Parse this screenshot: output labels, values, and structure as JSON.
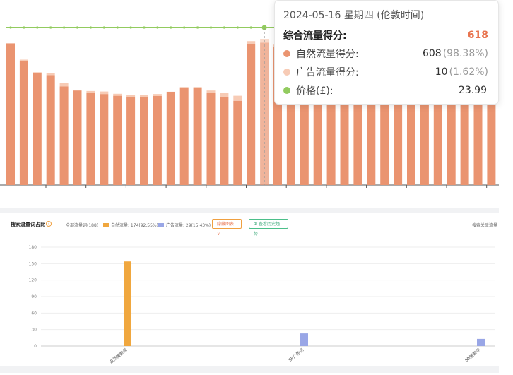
{
  "chart_data": [
    {
      "type": "bar",
      "stacked": true,
      "series": [
        {
          "name": "自然流量得分",
          "color": "#ea9470",
          "values": [
            565,
            495,
            447,
            438,
            393,
            377,
            367,
            363,
            356,
            352,
            352,
            355,
            372,
            386,
            386,
            367,
            352,
            336,
            562,
            568,
            550,
            550,
            550,
            550,
            550,
            550,
            550,
            550,
            550,
            550,
            550,
            550,
            550,
            550,
            550,
            550,
            550
          ]
        },
        {
          "name": "广告流量得分",
          "color": "#f7cbb5",
          "values": [
            0,
            5,
            3,
            8,
            15,
            0,
            8,
            10,
            8,
            8,
            8,
            8,
            0,
            5,
            5,
            10,
            15,
            20,
            12,
            15,
            10,
            10,
            10,
            10,
            10,
            10,
            10,
            10,
            10,
            10,
            10,
            10,
            10,
            10,
            10,
            10,
            10
          ]
        },
        {
          "name": "价格(£)",
          "color": "#92cb5f",
          "type": "line",
          "values": [
            23.99,
            23.99,
            23.99,
            23.99,
            23.99,
            23.99,
            23.99,
            23.99,
            23.99,
            23.99,
            23.99,
            23.99,
            23.99,
            23.99,
            23.99,
            23.99,
            23.99,
            23.99,
            23.99,
            23.99,
            23.99,
            23.99,
            23.99,
            23.99,
            23.99,
            23.99,
            23.99,
            23.99,
            23.99,
            23.99,
            23.99,
            23.99,
            23.99,
            23.99,
            23.99,
            23.99,
            23.99
          ]
        }
      ],
      "highlight_index": 19
    },
    {
      "type": "bar",
      "categories": [
        "自然搜索词",
        "SP广告词",
        "SB搜索词"
      ],
      "series": [
        {
          "name": "自然流量",
          "color": "#f0a73e",
          "values": [
            154,
            0,
            0
          ]
        },
        {
          "name": "广告流量",
          "color": "#99a6e6",
          "values": [
            0,
            23,
            13
          ]
        }
      ],
      "yticks": [
        "0",
        "30",
        "60",
        "90",
        "120",
        "150",
        "180"
      ],
      "ylim": [
        0,
        180
      ],
      "grid": true
    }
  ],
  "tooltip": {
    "date": "2024-05-16 星期四 (伦敦时间)",
    "total_label": "综合流量得分:",
    "total_value": "618",
    "rows": [
      {
        "label": "自然流量得分:",
        "value": "608",
        "pct": "(98.38%)",
        "color": "#ea9470"
      },
      {
        "label": "广告流量得分:",
        "value": "10",
        "pct": "(1.62%)",
        "color": "#f7cbb5"
      },
      {
        "label": "价格(£):",
        "value": "23.99",
        "pct": "",
        "color": "#92cb5f"
      }
    ]
  },
  "toolbar": {
    "title": "搜索流量词占比",
    "help": "?",
    "all_label": "全部流量词(188)",
    "legend": [
      {
        "label": "自然流量: 174(92.55%)",
        "color": "#f0a73e"
      },
      {
        "label": "广告流量: 29(15.43%)",
        "color": "#99a6e6"
      }
    ],
    "hide_chart": "隐藏图表 ∨",
    "history_trend": "查看历史趋势",
    "right_label": "搜索关联流量"
  }
}
